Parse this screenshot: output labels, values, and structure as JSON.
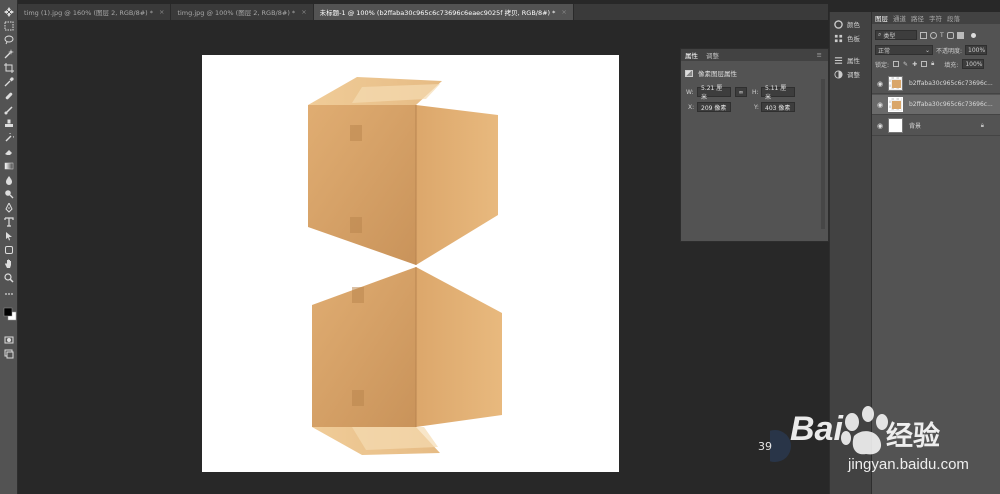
{
  "tabs": [
    {
      "label": "timg (1).jpg @ 160% (图层 2, RGB/8#) *",
      "close": "×"
    },
    {
      "label": "timg.jpg @ 100% (图层 2, RGB/8#) *",
      "close": "×"
    },
    {
      "label": "未标题-1 @ 100% (b2ffaba30c965c6c73696c6eaec9025f 拷贝, RGB/8#) *",
      "close": "×",
      "active": true
    }
  ],
  "icon_strip": {
    "items": [
      {
        "label": "颜色",
        "icon": "color-wheel-icon"
      },
      {
        "label": "色板",
        "icon": "swatches-icon"
      },
      {
        "label": "属性",
        "icon": "properties-icon"
      },
      {
        "label": "调整",
        "icon": "adjustments-icon"
      }
    ]
  },
  "properties": {
    "tabs": [
      "属性",
      "调整"
    ],
    "header": "像素图层属性",
    "w_label": "W:",
    "w_value": "5.21 厘米",
    "link": "∞",
    "h_label": "H:",
    "h_value": "5.11 厘米",
    "x_label": "X:",
    "x_value": "209 像素",
    "y_label": "Y:",
    "y_value": "403 像素"
  },
  "layers": {
    "tabs": [
      "图层",
      "通道",
      "路径",
      "字符",
      "段落"
    ],
    "filter_label": "类型",
    "blend_mode": "正常",
    "opacity_label": "不透明度:",
    "opacity_value": "100%",
    "lock_label": "锁定:",
    "fill_label": "填充:",
    "fill_value": "100%",
    "items": [
      {
        "name": "b2ffaba30c965c6c73696c...",
        "type": "box"
      },
      {
        "name": "b2ffaba30c965c6c73696c...",
        "type": "box",
        "selected": true
      },
      {
        "name": "背景",
        "type": "white",
        "locked": true
      }
    ]
  },
  "watermark": {
    "brand_left": "Bai",
    "brand_right": "经验",
    "url": "jingyan.baidu.com",
    "badge": "39"
  },
  "colors": {
    "workspace": "#282828",
    "panel": "#535353",
    "box_front": "#d9a66a",
    "box_side": "#e2b277",
    "box_top": "#ecc490"
  }
}
